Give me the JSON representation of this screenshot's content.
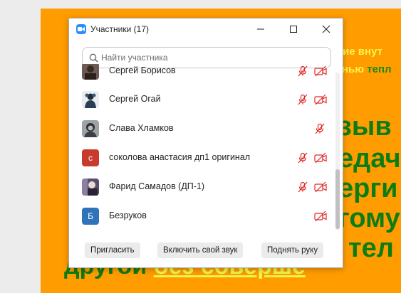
{
  "window": {
    "title": "Участники (17)",
    "controls": {
      "minimize": "minimize-icon",
      "maximize": "maximize-icon",
      "close": "close-icon"
    }
  },
  "search": {
    "placeholder": "Найти участника",
    "value": ""
  },
  "participants": [
    {
      "name": "Сергей Борисов",
      "avatar": "photo",
      "mic": "muted",
      "video": "off"
    },
    {
      "name": "Сергей Огай",
      "avatar": "photo",
      "mic": "muted",
      "video": "off"
    },
    {
      "name": "Слава Хламков",
      "avatar": "photo",
      "mic": "muted",
      "video": "none"
    },
    {
      "name": "соколова анастасия дп1 оригинал",
      "avatar_letter": "с",
      "avatar_color": "#c83a2e",
      "mic": "muted",
      "video": "off"
    },
    {
      "name": "Фарид Самадов (ДП-1)",
      "avatar": "photo",
      "mic": "muted",
      "video": "off"
    },
    {
      "name": "Безруков",
      "avatar_letter": "Б",
      "avatar_color": "#2f73b8",
      "mic": "none",
      "video": "off"
    }
  ],
  "footer": {
    "invite": "Пригласить",
    "unmute": "Включить свой звук",
    "raise_hand": "Поднять руку"
  },
  "background_slide": {
    "line1": "ние внут",
    "line2_a": "нью",
    "line2_b": " тепл",
    "big_lines": [
      "зыв",
      "едач",
      "ерги",
      "гому",
      "тел"
    ],
    "bottom_a": "другой ",
    "bottom_b": "без соверше"
  },
  "colors": {
    "muted_red": "#e02828",
    "accent_blue": "#2d8cff",
    "slide_orange": "#ff9c00",
    "slide_green": "#0b7d14",
    "slide_yellow": "#fff24a"
  }
}
